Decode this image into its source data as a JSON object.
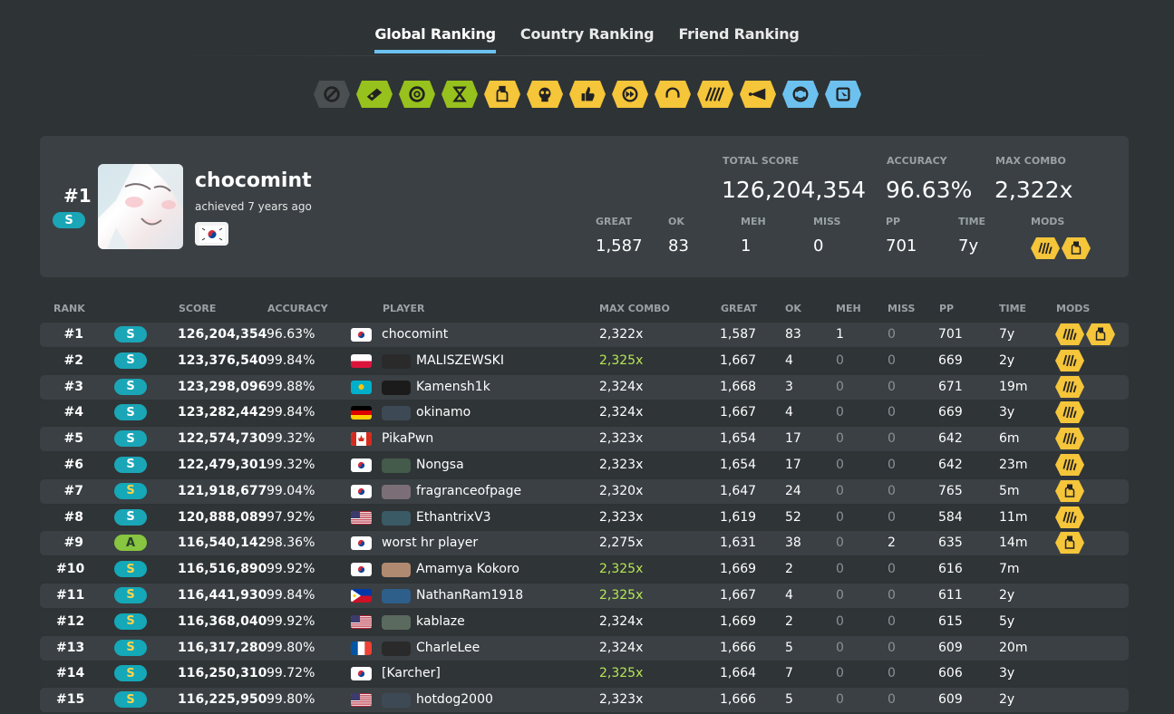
{
  "tabs": [
    {
      "label": "Global Ranking",
      "active": true
    },
    {
      "label": "Country Ranking",
      "active": false
    },
    {
      "label": "Friend Ranking",
      "active": false
    }
  ],
  "mod_filters": [
    {
      "icon": "no-mod-icon",
      "color": "#4a4f52"
    },
    {
      "icon": "easy-icon",
      "color": "#97c11c"
    },
    {
      "icon": "no-fail-icon",
      "color": "#97c11c"
    },
    {
      "icon": "half-time-icon",
      "color": "#97c11c"
    },
    {
      "icon": "sudden-death-icon",
      "color": "#f5c53a"
    },
    {
      "icon": "perfect-icon",
      "color": "#f5c53a"
    },
    {
      "icon": "hard-rock-icon",
      "color": "#f5c53a"
    },
    {
      "icon": "double-time-icon",
      "color": "#f5c53a"
    },
    {
      "icon": "hidden-icon",
      "color": "#f5c53a"
    },
    {
      "icon": "flashlight-icon",
      "color": "#f5c53a"
    },
    {
      "icon": "blinds-icon",
      "color": "#f5c53a"
    },
    {
      "icon": "relax-icon",
      "color": "#6cc1ef"
    },
    {
      "icon": "autopilot-icon",
      "color": "#6cc1ef"
    }
  ],
  "top": {
    "rank": "#1",
    "grade": "S",
    "name": "chocomint",
    "achieved": "achieved 7 years ago",
    "total_score_label": "Total Score",
    "total_score": "126,204,354",
    "accuracy_label": "Accuracy",
    "accuracy": "96.63%",
    "max_combo_label": "Max Combo",
    "max_combo": "2,322x",
    "great_label": "Great",
    "great": "1,587",
    "ok_label": "OK",
    "ok": "83",
    "meh_label": "Meh",
    "meh": "1",
    "miss_label": "Miss",
    "miss": "0",
    "pp_label": "PP",
    "pp": "701",
    "time_label": "Time",
    "time": "7y",
    "mods_label": "Mods",
    "mods": [
      "hidden-icon",
      "sudden-death-icon"
    ]
  },
  "headers": {
    "rank": "Rank",
    "score": "Score",
    "accuracy": "Accuracy",
    "player": "Player",
    "max_combo": "Max Combo",
    "great": "Great",
    "ok": "OK",
    "meh": "Meh",
    "miss": "Miss",
    "pp": "PP",
    "time": "Time",
    "mods": "Mods"
  },
  "colors": {
    "grade_s": "#14a8b8",
    "grade_sh": "#1aa6b7",
    "grade_s_text": "#ffd34a",
    "grade_a": "#88c540",
    "max_combo": "#b6e655",
    "tab_accent": "#6cc1ef",
    "mod_yellow": "#f5c53a"
  },
  "rows": [
    {
      "rank": "#1",
      "grade": "S",
      "grade_variant": "silver",
      "score": "126,204,354",
      "accuracy": "96.63%",
      "flag": "kr",
      "avatar": false,
      "player": "chocomint",
      "combo": "2,322x",
      "combo_max": false,
      "great": "1,587",
      "ok": "83",
      "meh": "1",
      "miss": "0",
      "pp": "701",
      "time": "7y",
      "mods": [
        "hidden-icon",
        "sudden-death-icon"
      ]
    },
    {
      "rank": "#2",
      "grade": "S",
      "grade_variant": "silver",
      "score": "123,376,540",
      "accuracy": "99.84%",
      "flag": "pl",
      "avatar": true,
      "player": "MALISZEWSKI",
      "combo": "2,325x",
      "combo_max": true,
      "great": "1,667",
      "ok": "4",
      "meh": "0",
      "miss": "0",
      "pp": "669",
      "time": "2y",
      "mods": [
        "hidden-icon"
      ]
    },
    {
      "rank": "#3",
      "grade": "S",
      "grade_variant": "silver",
      "score": "123,298,096",
      "accuracy": "99.88%",
      "flag": "kz",
      "avatar": true,
      "player": "Kamensh1k",
      "combo": "2,324x",
      "combo_max": false,
      "great": "1,668",
      "ok": "3",
      "meh": "0",
      "miss": "0",
      "pp": "671",
      "time": "19m",
      "mods": [
        "hidden-icon"
      ]
    },
    {
      "rank": "#4",
      "grade": "S",
      "grade_variant": "silver",
      "score": "123,282,442",
      "accuracy": "99.84%",
      "flag": "de",
      "avatar": true,
      "player": "okinamo",
      "combo": "2,324x",
      "combo_max": false,
      "great": "1,667",
      "ok": "4",
      "meh": "0",
      "miss": "0",
      "pp": "669",
      "time": "3y",
      "mods": [
        "hidden-icon"
      ]
    },
    {
      "rank": "#5",
      "grade": "S",
      "grade_variant": "silver",
      "score": "122,574,730",
      "accuracy": "99.32%",
      "flag": "ca",
      "avatar": false,
      "player": "PikaPwn",
      "combo": "2,323x",
      "combo_max": false,
      "great": "1,654",
      "ok": "17",
      "meh": "0",
      "miss": "0",
      "pp": "642",
      "time": "6m",
      "mods": [
        "hidden-icon"
      ]
    },
    {
      "rank": "#6",
      "grade": "S",
      "grade_variant": "silver",
      "score": "122,479,301",
      "accuracy": "99.32%",
      "flag": "kr",
      "avatar": true,
      "player": "Nongsa",
      "combo": "2,323x",
      "combo_max": false,
      "great": "1,654",
      "ok": "17",
      "meh": "0",
      "miss": "0",
      "pp": "642",
      "time": "23m",
      "mods": [
        "hidden-icon"
      ]
    },
    {
      "rank": "#7",
      "grade": "S",
      "grade_variant": "gold",
      "score": "121,918,677",
      "accuracy": "99.04%",
      "flag": "kr",
      "avatar": true,
      "player": "fragranceofpage",
      "combo": "2,320x",
      "combo_max": false,
      "great": "1,647",
      "ok": "24",
      "meh": "0",
      "miss": "0",
      "pp": "765",
      "time": "5m",
      "mods": [
        "sudden-death-icon"
      ]
    },
    {
      "rank": "#8",
      "grade": "S",
      "grade_variant": "silver",
      "score": "120,888,089",
      "accuracy": "97.92%",
      "flag": "us",
      "avatar": true,
      "player": "EthantrixV3",
      "combo": "2,323x",
      "combo_max": false,
      "great": "1,619",
      "ok": "52",
      "meh": "0",
      "miss": "0",
      "pp": "584",
      "time": "11m",
      "mods": [
        "hidden-icon"
      ]
    },
    {
      "rank": "#9",
      "grade": "A",
      "grade_variant": "a",
      "score": "116,540,142",
      "accuracy": "98.36%",
      "flag": "kr",
      "avatar": false,
      "player": "worst hr player",
      "combo": "2,275x",
      "combo_max": false,
      "great": "1,631",
      "ok": "38",
      "meh": "0",
      "miss": "2",
      "pp": "635",
      "time": "14m",
      "mods": [
        "sudden-death-icon"
      ]
    },
    {
      "rank": "#10",
      "grade": "S",
      "grade_variant": "gold",
      "score": "116,516,890",
      "accuracy": "99.92%",
      "flag": "kr",
      "avatar": true,
      "player": "Amamya Kokoro",
      "combo": "2,325x",
      "combo_max": true,
      "great": "1,669",
      "ok": "2",
      "meh": "0",
      "miss": "0",
      "pp": "616",
      "time": "7m",
      "mods": []
    },
    {
      "rank": "#11",
      "grade": "S",
      "grade_variant": "gold",
      "score": "116,441,930",
      "accuracy": "99.84%",
      "flag": "ph",
      "avatar": true,
      "player": "NathanRam1918",
      "combo": "2,325x",
      "combo_max": true,
      "great": "1,667",
      "ok": "4",
      "meh": "0",
      "miss": "0",
      "pp": "611",
      "time": "2y",
      "mods": []
    },
    {
      "rank": "#12",
      "grade": "S",
      "grade_variant": "gold",
      "score": "116,368,040",
      "accuracy": "99.92%",
      "flag": "us",
      "avatar": true,
      "player": "kablaze",
      "combo": "2,324x",
      "combo_max": false,
      "great": "1,669",
      "ok": "2",
      "meh": "0",
      "miss": "0",
      "pp": "615",
      "time": "5y",
      "mods": []
    },
    {
      "rank": "#13",
      "grade": "S",
      "grade_variant": "gold",
      "score": "116,317,280",
      "accuracy": "99.80%",
      "flag": "fr",
      "avatar": true,
      "player": "CharleLee",
      "combo": "2,324x",
      "combo_max": false,
      "great": "1,666",
      "ok": "5",
      "meh": "0",
      "miss": "0",
      "pp": "609",
      "time": "20m",
      "mods": []
    },
    {
      "rank": "#14",
      "grade": "S",
      "grade_variant": "gold",
      "score": "116,250,310",
      "accuracy": "99.72%",
      "flag": "kr",
      "avatar": false,
      "player": "[Karcher]",
      "combo": "2,325x",
      "combo_max": true,
      "great": "1,664",
      "ok": "7",
      "meh": "0",
      "miss": "0",
      "pp": "606",
      "time": "3y",
      "mods": []
    },
    {
      "rank": "#15",
      "grade": "S",
      "grade_variant": "gold",
      "score": "116,225,950",
      "accuracy": "99.80%",
      "flag": "us",
      "avatar": true,
      "player": "hotdog2000",
      "combo": "2,323x",
      "combo_max": false,
      "great": "1,666",
      "ok": "5",
      "meh": "0",
      "miss": "0",
      "pp": "609",
      "time": "2y",
      "mods": []
    }
  ]
}
